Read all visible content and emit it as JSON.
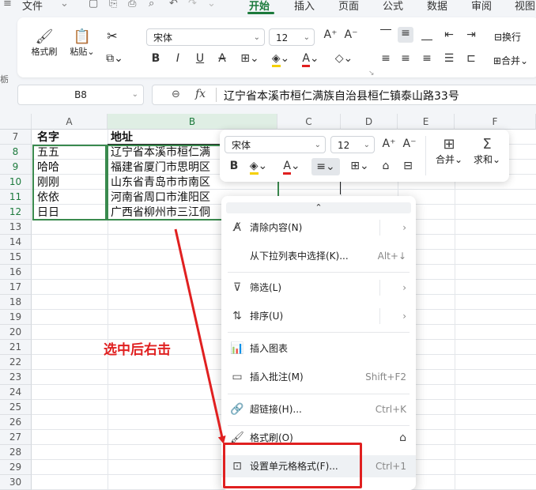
{
  "menubar": {
    "file": "文件",
    "tabs": [
      "开始",
      "插入",
      "页面",
      "公式",
      "数据",
      "审阅",
      "视图"
    ]
  },
  "ribbon": {
    "format_painter": "格式刷",
    "paste": "粘贴",
    "font_name": "宋体",
    "font_size": "12",
    "wrap_text": "换行",
    "merge": "合并"
  },
  "formula_bar": {
    "name_box": "B8",
    "fx": "fx",
    "content": "辽宁省本溪市桓仁满族自治县桓仁镇泰山路33号"
  },
  "columns": [
    "A",
    "B",
    "C",
    "D",
    "E",
    "F"
  ],
  "rows": [
    "7",
    "8",
    "9",
    "10",
    "11",
    "12",
    "13",
    "14",
    "15",
    "16",
    "17",
    "18",
    "19",
    "20",
    "21",
    "22",
    "23",
    "24",
    "25",
    "26",
    "27",
    "28",
    "29",
    "30"
  ],
  "table": {
    "header": {
      "name": "名字",
      "address": "地址"
    },
    "data": [
      {
        "name": "五五",
        "address": "辽宁省本溪市桓仁满"
      },
      {
        "name": "哈哈",
        "address": "福建省厦门市思明区"
      },
      {
        "name": "刚刚",
        "address": "山东省青岛市市南区"
      },
      {
        "name": "依依",
        "address": "河南省周口市淮阳区"
      },
      {
        "name": "日日",
        "address": "广西省柳州市三江侗"
      }
    ]
  },
  "mini_toolbar": {
    "font_name": "宋体",
    "font_size": "12",
    "merge": "合并",
    "sum": "求和"
  },
  "context_menu": {
    "items": [
      {
        "label": "清除内容(N)",
        "shortcut": "",
        "icon": "clear-content-icon"
      },
      {
        "label": "从下拉列表中选择(K)...",
        "shortcut": "Alt+↓",
        "icon": ""
      },
      {
        "label": "筛选(L)",
        "shortcut": "",
        "icon": "filter-icon"
      },
      {
        "label": "排序(U)",
        "shortcut": "",
        "icon": "sort-icon"
      },
      {
        "label": "插入图表",
        "shortcut": "",
        "icon": "chart-icon"
      },
      {
        "label": "插入批注(M)",
        "shortcut": "Shift+F2",
        "icon": "comment-icon"
      },
      {
        "label": "超链接(H)...",
        "shortcut": "Ctrl+K",
        "icon": "link-icon"
      },
      {
        "label": "格式刷(O)",
        "shortcut": "",
        "icon": "format-painter-icon"
      },
      {
        "label": "设置单元格格式(F)...",
        "shortcut": "Ctrl+1",
        "icon": "format-cells-icon"
      }
    ]
  },
  "annotation": {
    "text": "选中后右击",
    "color": "#e02020"
  },
  "colors": {
    "accent": "#1c7a3c",
    "selection_border": "#3a8a4e",
    "annotation": "#e02020"
  }
}
